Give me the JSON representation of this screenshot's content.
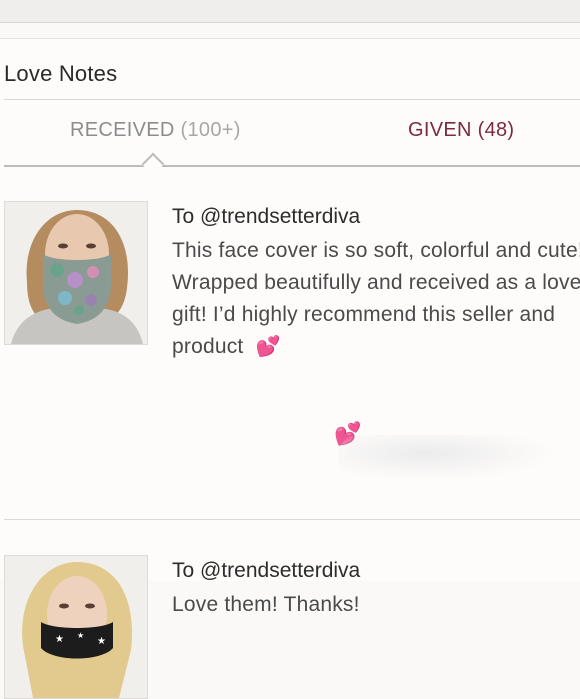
{
  "header": {
    "title": "Love Notes"
  },
  "tabs": {
    "received": {
      "label": "RECEIVED",
      "count": "(100+)"
    },
    "given": {
      "label": "GIVEN",
      "count": "(48)"
    }
  },
  "notes": [
    {
      "recipient": "To @trendsetterdiva",
      "body": "This face cover is so soft, colorful and cute! Wrapped beautifully and received as a lovely gift! I’d highly recommend this seller and product",
      "hearts": "💕"
    },
    {
      "recipient": "To @trendsetterdiva",
      "body": "Love them! Thanks!"
    }
  ],
  "floating_icon": "💕",
  "colors": {
    "accent": "#7a2b3f",
    "muted_tab": "#8c8c8c",
    "heart": "#e53d99"
  }
}
